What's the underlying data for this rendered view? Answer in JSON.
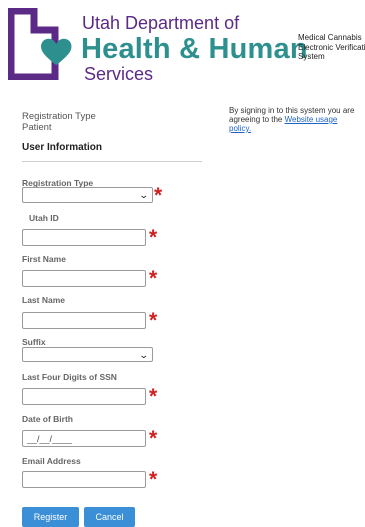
{
  "header": {
    "logo_line1": "Utah Department of",
    "logo_line2": "Health & Human",
    "logo_line3": "Services",
    "system_line1": "Medical Cannabis",
    "system_line2": "Electronic Verification",
    "system_line3": "System",
    "logo_colors": {
      "purple": "#5b2a86",
      "teal": "#2e8f8f"
    }
  },
  "notice": {
    "text": "By signing in to this system you are agreeing to the",
    "link_label": "Website usage policy."
  },
  "registration": {
    "label": "Registration Type",
    "value": "Patient"
  },
  "section_title": "User Information",
  "fields": {
    "registration_type": {
      "label": "Registration Type",
      "value": "",
      "required": true
    },
    "utah_id": {
      "label": "Utah ID",
      "value": "",
      "required": true
    },
    "first_name": {
      "label": "First Name",
      "value": "",
      "required": true
    },
    "last_name": {
      "label": "Last Name",
      "value": "",
      "required": true
    },
    "suffix": {
      "label": "Suffix",
      "value": "",
      "required": false
    },
    "ssn_last4": {
      "label": "Last Four Digits of SSN",
      "value": "",
      "required": true
    },
    "dob": {
      "label": "Date of Birth",
      "value": "__/__/____",
      "required": true
    },
    "email": {
      "label": "Email Address",
      "value": "",
      "required": true
    }
  },
  "required_marker": "*",
  "buttons": {
    "register": "Register",
    "cancel": "Cancel"
  },
  "colors": {
    "required": "#d21f1f",
    "button": "#3a8fd6",
    "link": "#1f63c6"
  }
}
